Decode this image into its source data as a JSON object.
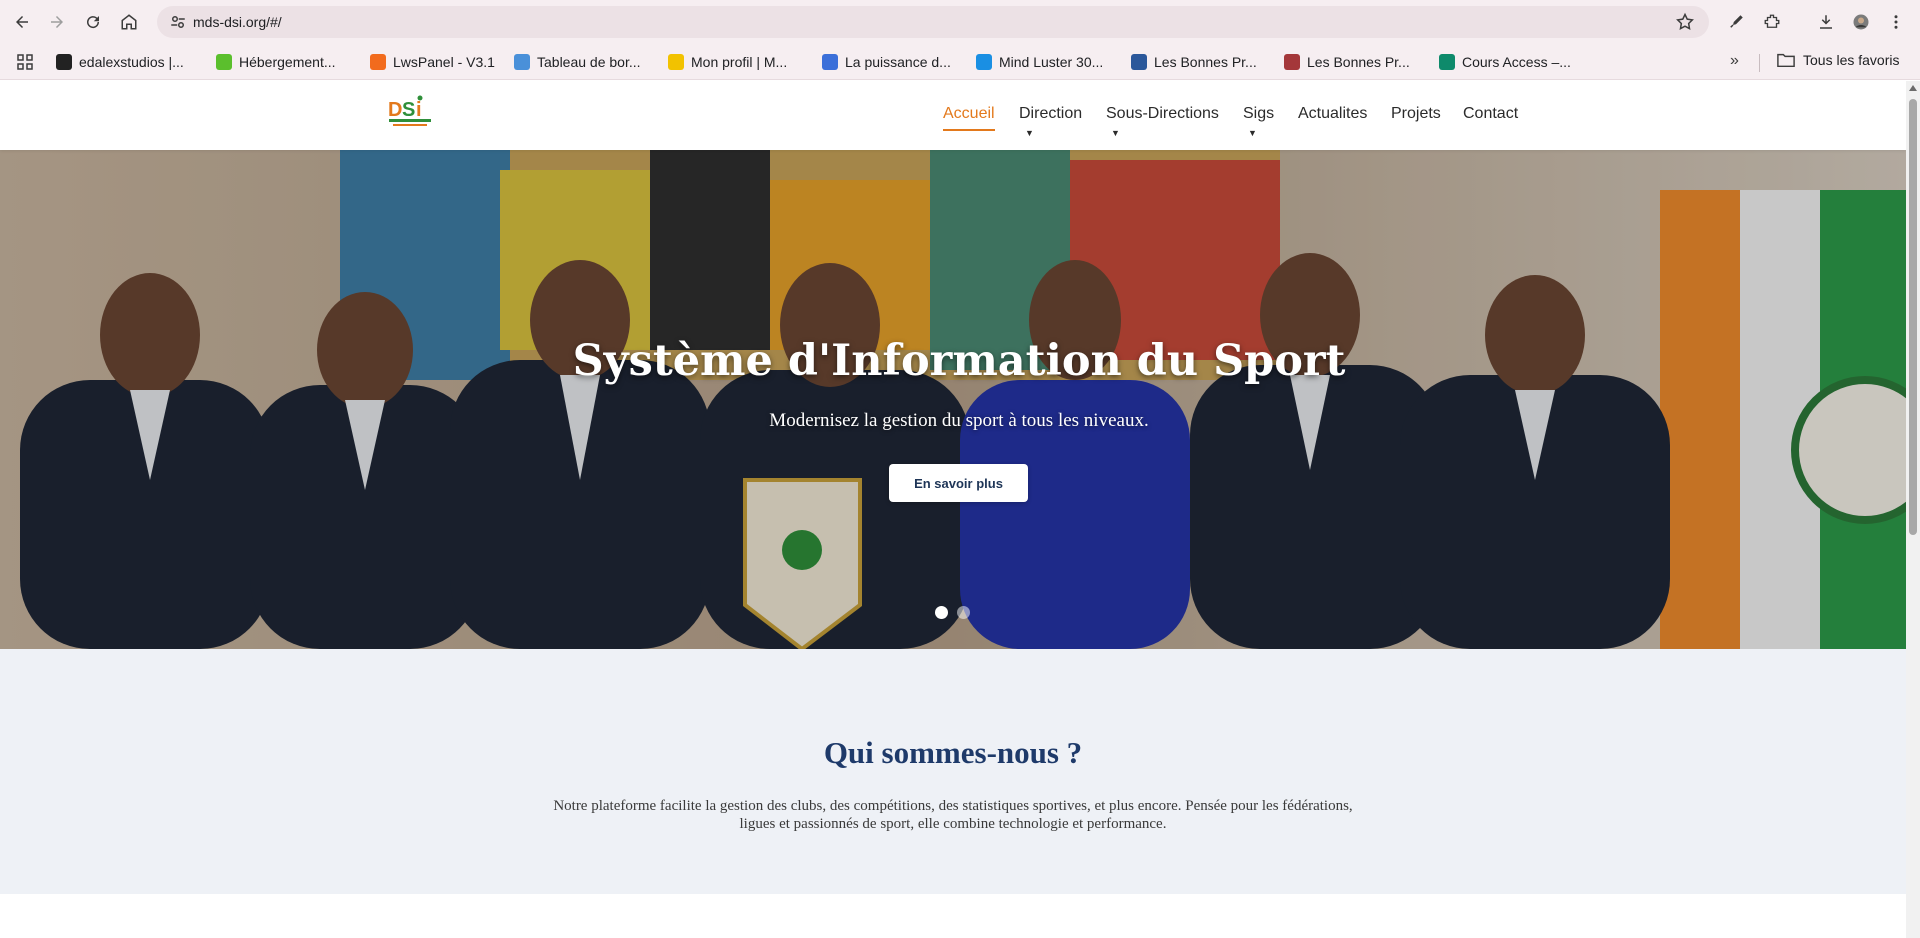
{
  "browser": {
    "url": "mds-dsi.org/#/",
    "bookmarks": [
      {
        "label": "edalexstudios |...",
        "icon": "edalex-icon",
        "color": "#222222"
      },
      {
        "label": "Hébergement...",
        "icon": "hosting-icon",
        "color": "#5bbf2d"
      },
      {
        "label": "LwsPanel - V3.1",
        "icon": "lws-icon",
        "color": "#f26b1d"
      },
      {
        "label": "Tableau de bor...",
        "icon": "dashboard-icon",
        "color": "#4a90d9"
      },
      {
        "label": "Mon profil | M...",
        "icon": "profile-icon",
        "color": "#f2c200"
      },
      {
        "label": "La puissance d...",
        "icon": "article-icon",
        "color": "#3b6fd9"
      },
      {
        "label": "Mind Luster 30...",
        "icon": "mindluster-icon",
        "color": "#1a8fe3"
      },
      {
        "label": "Les Bonnes Pr...",
        "icon": "word-icon",
        "color": "#2b579a"
      },
      {
        "label": "Les Bonnes Pr...",
        "icon": "access-icon",
        "color": "#a4373a"
      },
      {
        "label": "Cours Access –...",
        "icon": "course-icon",
        "color": "#0e8a6b"
      }
    ],
    "all_bookmarks_label": "Tous les favoris",
    "more_label": "»"
  },
  "site": {
    "nav": [
      {
        "label": "Accueil",
        "active": true,
        "has_dropdown": false
      },
      {
        "label": "Direction",
        "active": false,
        "has_dropdown": true
      },
      {
        "label": "Sous-Directions",
        "active": false,
        "has_dropdown": true
      },
      {
        "label": "Sigs",
        "active": false,
        "has_dropdown": true
      },
      {
        "label": "Actualites",
        "active": false,
        "has_dropdown": false
      },
      {
        "label": "Projets",
        "active": false,
        "has_dropdown": false
      },
      {
        "label": "Contact",
        "active": false,
        "has_dropdown": false
      }
    ],
    "caret": "▼",
    "accent_color": "#e3791c",
    "hero": {
      "title": "Système d'Information du Sport",
      "subtitle": "Modernisez la gestion du sport à tous les niveaux.",
      "button": "En savoir plus",
      "slides_total": 2,
      "slide_active": 1
    },
    "about": {
      "title": "Qui sommes-nous ?",
      "text": "Notre plateforme facilite la gestion des clubs, des compétitions, des statistiques sportives, et plus encore. Pensée pour les fédérations, ligues et passionnés de sport, elle combine technologie et performance."
    }
  }
}
